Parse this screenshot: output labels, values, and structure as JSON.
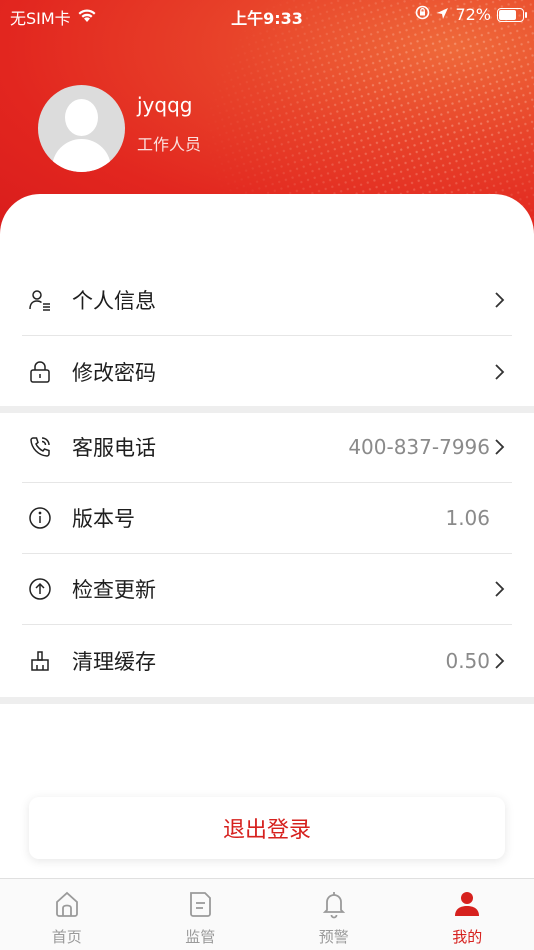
{
  "status_bar": {
    "carrier": "无SIM卡",
    "time": "上午9:33",
    "battery": "72%",
    "battery_level": 0.72
  },
  "profile": {
    "username": "jyqqg",
    "role": "工作人员"
  },
  "menu_group1": [
    {
      "label": "个人信息",
      "icon": "user-list-icon",
      "value": ""
    },
    {
      "label": "修改密码",
      "icon": "lock-icon",
      "value": ""
    }
  ],
  "menu_group2": [
    {
      "label": "客服电话",
      "icon": "phone-icon",
      "value": "400-837-7996"
    },
    {
      "label": "版本号",
      "icon": "info-icon",
      "value": "1.06"
    },
    {
      "label": "检查更新",
      "icon": "upload-arrow-icon",
      "value": ""
    },
    {
      "label": "清理缓存",
      "icon": "broom-icon",
      "value": "0.50"
    }
  ],
  "logout_label": "退出登录",
  "tabs": [
    {
      "label": "首页",
      "icon": "home-icon",
      "active": false
    },
    {
      "label": "监管",
      "icon": "document-icon",
      "active": false
    },
    {
      "label": "预警",
      "icon": "bell-icon",
      "active": false
    },
    {
      "label": "我的",
      "icon": "person-icon",
      "active": true
    }
  ],
  "colors": {
    "accent": "#d6211e",
    "header_start": "#e2261f",
    "header_end": "#ef6a3a"
  }
}
